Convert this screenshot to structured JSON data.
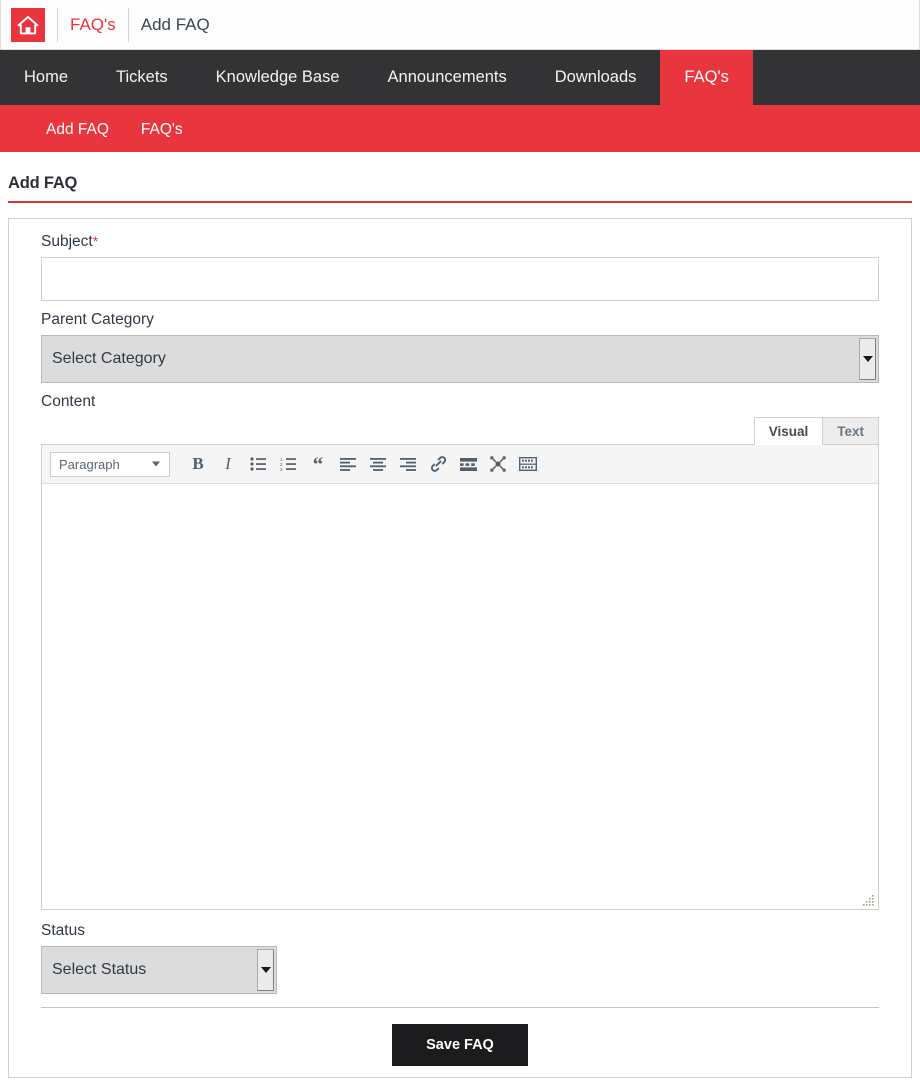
{
  "breadcrumb": {
    "home_icon": "home-icon",
    "items": [
      {
        "label": "FAQ's",
        "type": "link"
      },
      {
        "label": "Add FAQ",
        "type": "current"
      }
    ]
  },
  "main_nav": {
    "items": [
      {
        "label": "Home",
        "active": false
      },
      {
        "label": "Tickets",
        "active": false
      },
      {
        "label": "Knowledge Base",
        "active": false
      },
      {
        "label": "Announcements",
        "active": false
      },
      {
        "label": "Downloads",
        "active": false
      },
      {
        "label": "FAQ's",
        "active": true
      }
    ]
  },
  "sub_nav": {
    "items": [
      {
        "label": "Add FAQ"
      },
      {
        "label": "FAQ's"
      }
    ]
  },
  "page": {
    "title": "Add FAQ"
  },
  "form": {
    "subject": {
      "label": "Subject",
      "required_marker": "*",
      "value": "",
      "placeholder": ""
    },
    "parent_category": {
      "label": "Parent Category",
      "selected": "Select Category",
      "options": [
        "Select Category"
      ]
    },
    "content": {
      "label": "Content",
      "tabs": [
        {
          "label": "Visual",
          "active": true
        },
        {
          "label": "Text",
          "active": false
        }
      ],
      "toolbar": {
        "format_select": {
          "selected": "Paragraph",
          "options": [
            "Paragraph"
          ]
        },
        "buttons": [
          {
            "name": "bold-icon",
            "glyph": "B"
          },
          {
            "name": "italic-icon",
            "glyph": "I"
          },
          {
            "name": "bullet-list-icon",
            "glyph": ""
          },
          {
            "name": "numbered-list-icon",
            "glyph": ""
          },
          {
            "name": "blockquote-icon",
            "glyph": "“"
          },
          {
            "name": "align-left-icon",
            "glyph": ""
          },
          {
            "name": "align-center-icon",
            "glyph": ""
          },
          {
            "name": "align-right-icon",
            "glyph": ""
          },
          {
            "name": "insert-link-icon",
            "glyph": ""
          },
          {
            "name": "insert-read-more-icon",
            "glyph": ""
          },
          {
            "name": "fullscreen-icon",
            "glyph": ""
          },
          {
            "name": "toolbar-toggle-icon",
            "glyph": ""
          }
        ]
      },
      "body_value": ""
    },
    "status": {
      "label": "Status",
      "selected": "Select Status",
      "options": [
        "Select Status"
      ]
    },
    "save_button": "Save FAQ"
  },
  "colors": {
    "accent_red": "#e8353e",
    "nav_dark": "#333336",
    "title_rule": "#d8323b",
    "save_button_bg": "#1c1c1e"
  }
}
